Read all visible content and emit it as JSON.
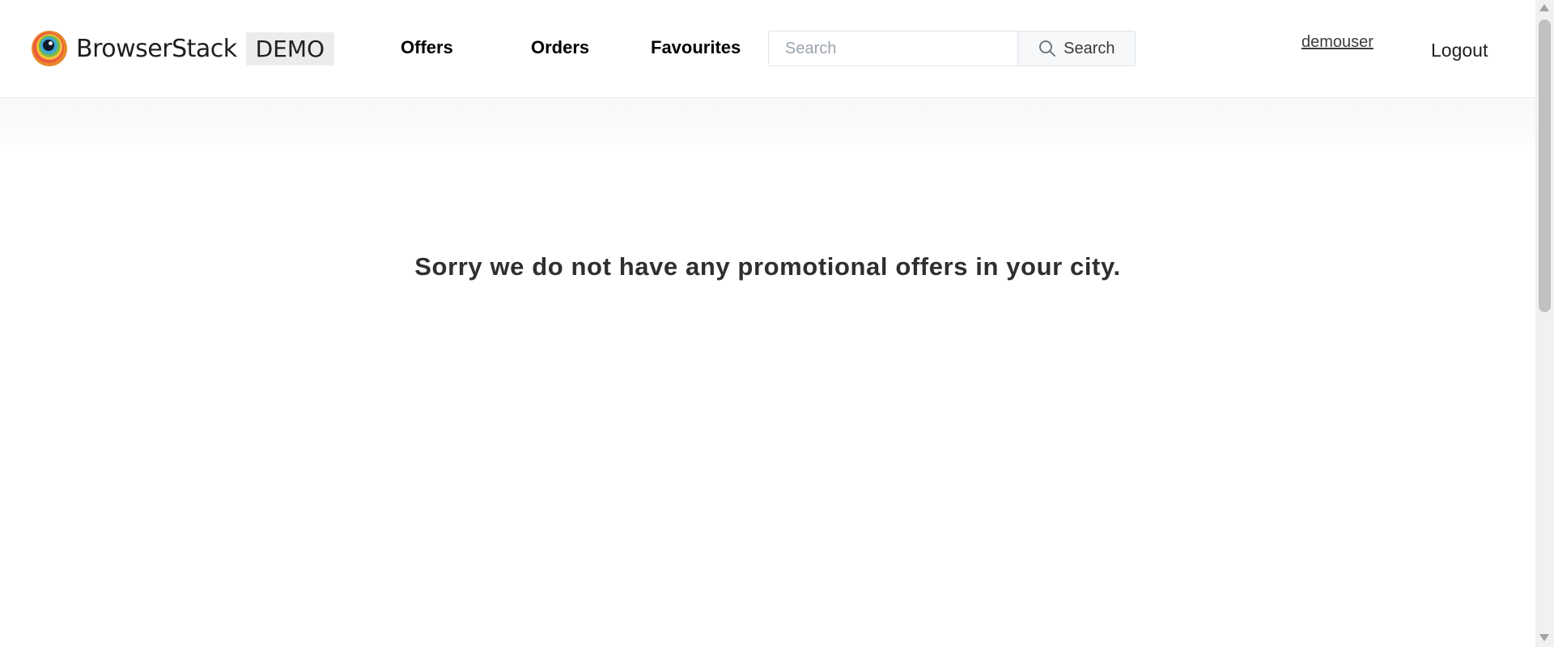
{
  "brand": {
    "name": "BrowserStack",
    "badge": "DEMO",
    "logo_icon": "browserstack-eye-logo"
  },
  "nav": {
    "items": [
      {
        "label": "Offers"
      },
      {
        "label": "Orders"
      },
      {
        "label": "Favourites"
      }
    ]
  },
  "search": {
    "placeholder": "Search",
    "value": "",
    "button_label": "Search",
    "icon": "search-icon"
  },
  "user": {
    "username": "demouser",
    "logout_label": "Logout"
  },
  "main": {
    "message": "Sorry we do not have any promotional offers in your city."
  },
  "colors": {
    "text_dark": "#2f2f2f",
    "nav_text": "#000000",
    "search_placeholder": "#9aa3ad",
    "search_button_bg": "#f6f8fa",
    "badge_bg": "#ececec"
  }
}
